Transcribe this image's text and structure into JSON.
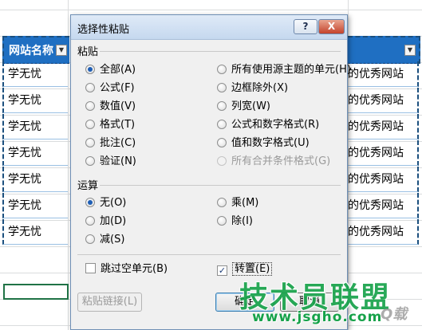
{
  "spreadsheet": {
    "header_left": "网站名称",
    "header_right": "",
    "left_cells": [
      "学无忧",
      "学无忧",
      "学无忧",
      "学无忧",
      "学无忧",
      "学无忧",
      "学无忧"
    ],
    "right_cells": [
      "的优秀网站",
      "的优秀网站",
      "的优秀网站",
      "的优秀网站",
      "的优秀网站",
      "的优秀网站",
      "的优秀网站"
    ]
  },
  "dialog": {
    "title": "选择性粘贴",
    "help_label": "?",
    "close_label": "X",
    "paste_section": "粘贴",
    "paste_options_left": [
      {
        "label": "全部(A)",
        "selected": true
      },
      {
        "label": "公式(F)",
        "selected": false
      },
      {
        "label": "数值(V)",
        "selected": false
      },
      {
        "label": "格式(T)",
        "selected": false
      },
      {
        "label": "批注(C)",
        "selected": false
      },
      {
        "label": "验证(N)",
        "selected": false
      }
    ],
    "paste_options_right": [
      {
        "label": "所有使用源主题的单元(H)",
        "selected": false
      },
      {
        "label": "边框除外(X)",
        "selected": false
      },
      {
        "label": "列宽(W)",
        "selected": false
      },
      {
        "label": "公式和数字格式(R)",
        "selected": false
      },
      {
        "label": "值和数字格式(U)",
        "selected": false
      },
      {
        "label": "所有合并条件格式(G)",
        "selected": false,
        "disabled": true
      }
    ],
    "operation_section": "运算",
    "operation_left": [
      {
        "label": "无(O)",
        "selected": true
      },
      {
        "label": "加(D)",
        "selected": false
      },
      {
        "label": "减(S)",
        "selected": false
      }
    ],
    "operation_right": [
      {
        "label": "乘(M)",
        "selected": false
      },
      {
        "label": "除(I)",
        "selected": false
      }
    ],
    "skip_blanks": {
      "label": "跳过空单元(B)",
      "checked": false
    },
    "transpose": {
      "label": "转置(E)",
      "checked": true
    },
    "paste_link_label": "粘贴链接(L)",
    "ok_label": "确定",
    "cancel_label": "取消"
  },
  "watermark": {
    "main": "技术员联盟",
    "url": "www.jsgho.com",
    "logo": "Q载"
  },
  "colors": {
    "header_fill": "#1f6fc2",
    "selection_border": "#207346",
    "radio_dot": "#1e5eb5",
    "watermark": "#17a24a"
  }
}
